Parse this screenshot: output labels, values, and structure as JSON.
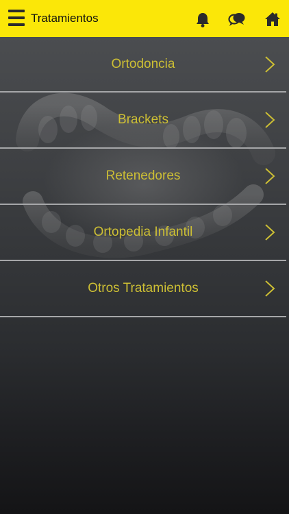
{
  "header": {
    "title": "Tratamientos",
    "menu_icon": "hamburger-menu-icon",
    "icons": [
      "bell-icon",
      "chat-bubbles-icon",
      "home-icon"
    ]
  },
  "menu": {
    "items": [
      {
        "label": "Ortodoncia"
      },
      {
        "label": "Brackets"
      },
      {
        "label": "Retenedores"
      },
      {
        "label": "Ortopedia Infantil"
      },
      {
        "label": "Otros Tratamientos"
      }
    ]
  },
  "colors": {
    "topbar": "#fbe708",
    "label": "#cdbf34",
    "divider": "#a6a7a9",
    "icon_dark": "#2b2b2b"
  }
}
